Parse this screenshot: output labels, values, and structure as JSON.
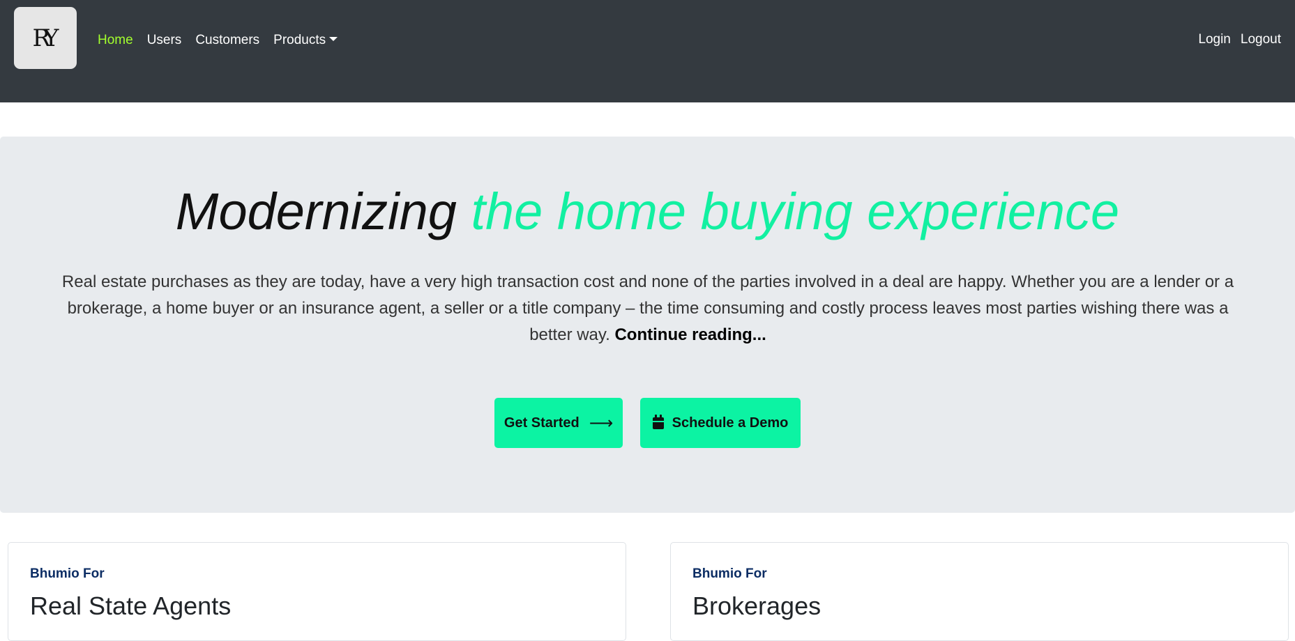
{
  "navbar": {
    "brand_text": "RY",
    "links": [
      {
        "label": "Home",
        "active": true
      },
      {
        "label": "Users",
        "active": false
      },
      {
        "label": "Customers",
        "active": false
      },
      {
        "label": "Products",
        "active": false
      }
    ],
    "login_label": "Login",
    "logout_label": "Logout"
  },
  "hero": {
    "title_plain": "Modernizing ",
    "title_accent": "the home buying experience",
    "text": "Real estate purchases as they are today, have a very high transaction cost and none of the parties involved in a deal are happy. Whether you are a lender or a brokerage, a home buyer or an insurance agent, a seller or a title company – the time consuming and costly process leaves most parties wishing there was a better way.",
    "continue_label": "Continue reading...",
    "get_started_label": "Get Started",
    "get_started_icon": "arrow-right-icon",
    "demo_label": "Schedule a Demo",
    "demo_icon": "calendar-icon"
  },
  "cards": [
    {
      "eyebrow": "Bhumio For",
      "title": "Real State Agents"
    },
    {
      "eyebrow": "Bhumio For",
      "title": "Brokerages"
    }
  ],
  "colors": {
    "navbar_bg": "#343a40",
    "active_link": "#a3ff2d",
    "accent": "#12f0a1",
    "button_bg": "#0cf3a3",
    "hero_bg": "#e8ebee",
    "eyebrow": "#0c2d64"
  }
}
